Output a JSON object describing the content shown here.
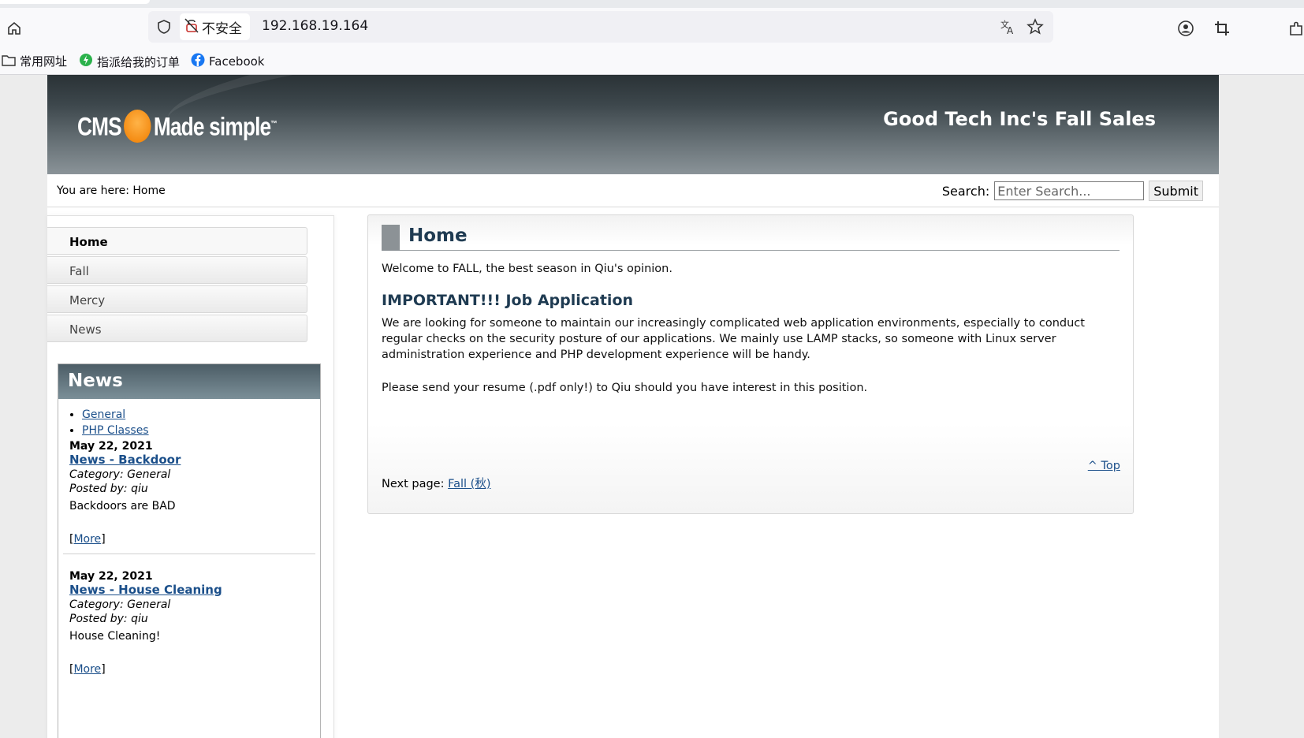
{
  "browser": {
    "url": "192.168.19.164",
    "security_label": "不安全",
    "bookmarks": [
      {
        "label": "常用网址",
        "icon": "folder-icon"
      },
      {
        "label": "指派给我的订单",
        "icon": "app-icon"
      },
      {
        "label": "Facebook",
        "icon": "facebook-icon"
      }
    ]
  },
  "site": {
    "logo_text": "CMS Made simple",
    "title": "Good Tech Inc's Fall Sales",
    "breadcrumb": "You are here:  Home",
    "search": {
      "label": "Search:",
      "placeholder": "Enter Search...",
      "button": "Submit"
    }
  },
  "menu": {
    "items": [
      {
        "label": "Home"
      },
      {
        "label": "Fall"
      },
      {
        "label": "Mercy"
      },
      {
        "label": "News"
      }
    ]
  },
  "news": {
    "heading": "News",
    "categories": [
      "General",
      "PHP Classes"
    ],
    "articles": [
      {
        "date": "May 22, 2021",
        "title": "News - Backdoor",
        "category": "Category: General",
        "posted": "Posted by: qiu",
        "summary": "Backdoors are BAD",
        "more": "More"
      },
      {
        "date": "May 22, 2021",
        "title": "News - House Cleaning",
        "category": "Category: General",
        "posted": "Posted by: qiu",
        "summary": "House Cleaning!",
        "more": "More"
      }
    ]
  },
  "content": {
    "heading": "Home",
    "intro": "Welcome to FALL, the best season in Qiu's opinion.",
    "subheading": "IMPORTANT!!! Job Application",
    "paragraph1": "We are looking for someone to maintain our increasingly complicated web application environments, especially to conduct regular checks on the security posture of our applications. We mainly use LAMP stacks, so someone with Linux server administration experience and PHP development experience will be handy.",
    "paragraph2": "Please send your resume (.pdf only!) to Qiu should you have interest in this position.",
    "top_link": "^ Top",
    "next_label": "Next page: ",
    "next_link": "Fall (秋)"
  },
  "colors": {
    "link": "#1b4f8a",
    "heading": "#1f3b52",
    "header_dark": "#2a3236",
    "news_header": "#5b6d76"
  }
}
